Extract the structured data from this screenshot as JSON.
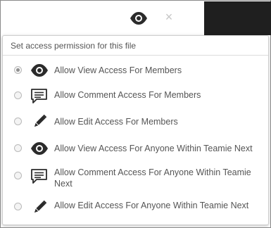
{
  "toolbar": {
    "view_icon": "eye-icon",
    "close_icon": "close-icon",
    "close_glyph": "×"
  },
  "dropdown": {
    "header": "Set access permission for this file",
    "options": [
      {
        "label": "Allow View Access For Members",
        "icon": "eye-icon",
        "selected": true
      },
      {
        "label": "Allow Comment Access For Members",
        "icon": "comment-icon",
        "selected": false
      },
      {
        "label": "Allow Edit Access For Members",
        "icon": "pencil-icon",
        "selected": false
      },
      {
        "label": "Allow View Access For Anyone Within Teamie Next",
        "icon": "eye-icon",
        "selected": false
      },
      {
        "label": "Allow Comment Access For Anyone Within Teamie Next",
        "icon": "comment-icon",
        "selected": false
      },
      {
        "label": "Allow Edit Access For Anyone Within Teamie Next",
        "icon": "pencil-icon",
        "selected": false
      }
    ]
  },
  "colors": {
    "text": "#555555",
    "icon": "#2b2b2b",
    "dark_panel": "#1f1f1f"
  }
}
